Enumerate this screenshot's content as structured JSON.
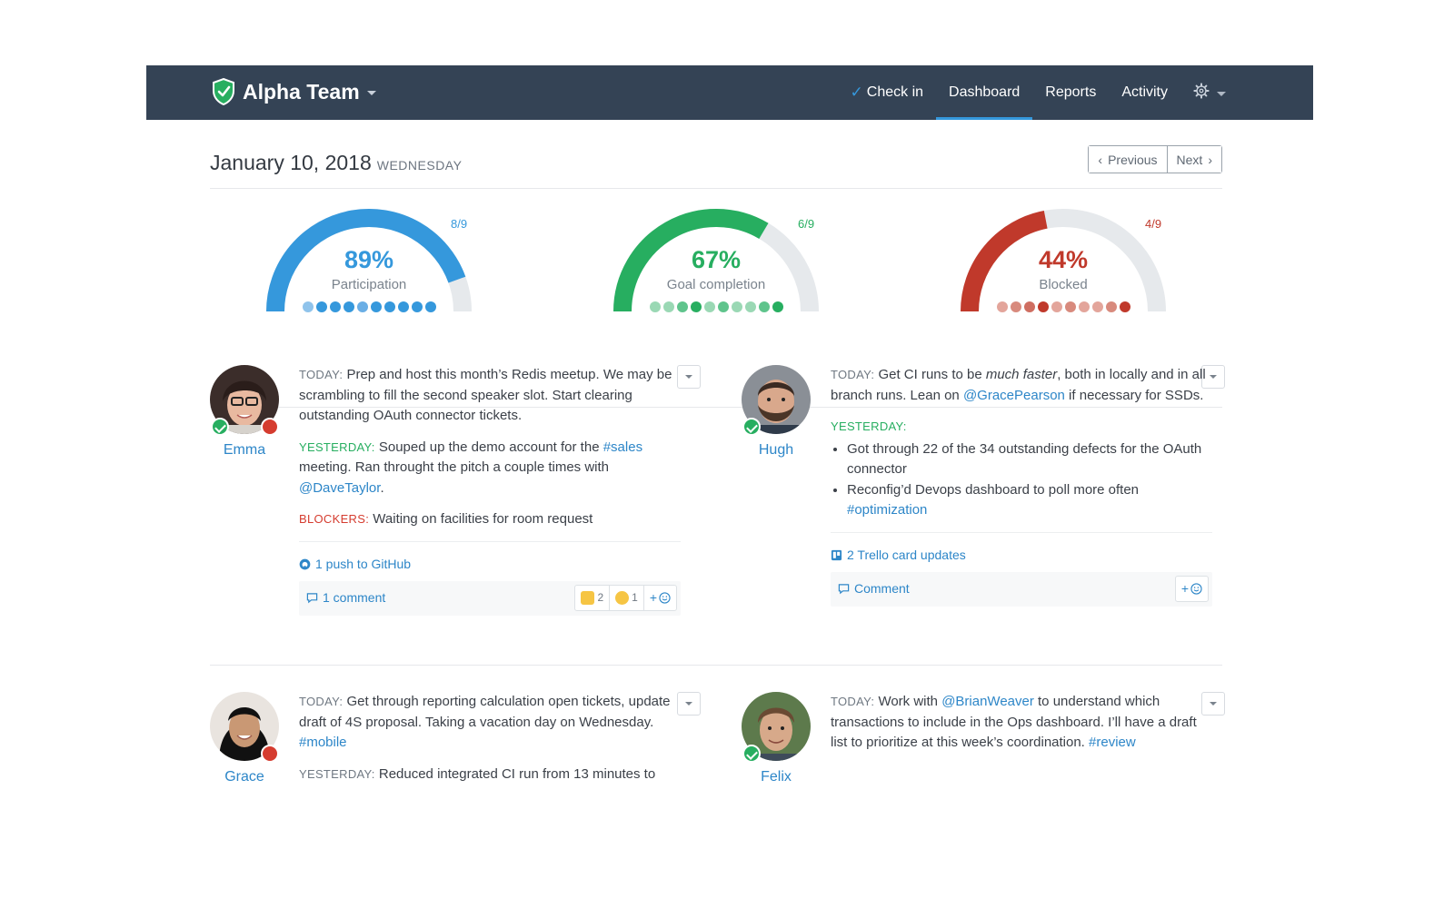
{
  "nav": {
    "team_name": "Alpha Team",
    "links": [
      {
        "label": "Check in",
        "active": false
      },
      {
        "label": "Dashboard",
        "active": true
      },
      {
        "label": "Reports",
        "active": false
      },
      {
        "label": "Activity",
        "active": false
      }
    ],
    "settings_icon": "gear-icon"
  },
  "date": {
    "main": "January 10, 2018",
    "day": "WEDNESDAY",
    "prev_label": "Previous",
    "next_label": "Next"
  },
  "gauges": [
    {
      "percent": 0.89,
      "percent_text": "89%",
      "label": "Participation",
      "fraction": "8/9",
      "color": "#3598dc",
      "dot_colors": [
        "#8fc3eb",
        "#3598dc",
        "#3598dc",
        "#3598dc",
        "#6aaee5",
        "#3598dc",
        "#3598dc",
        "#3598dc",
        "#3598dc",
        "#3598dc"
      ]
    },
    {
      "percent": 0.67,
      "percent_text": "67%",
      "label": "Goal completion",
      "fraction": "6/9",
      "color": "#27ae60",
      "dot_colors": [
        "#9ad8b4",
        "#9ad8b4",
        "#5fc48c",
        "#27ae60",
        "#9ad8b4",
        "#5fc48c",
        "#9ad8b4",
        "#9ad8b4",
        "#5fc48c",
        "#27ae60"
      ]
    },
    {
      "percent": 0.44,
      "percent_text": "44%",
      "label": "Blocked",
      "fraction": "4/9",
      "color": "#c0392b",
      "dot_colors": [
        "#e3a59b",
        "#d88a7d",
        "#cf6e61",
        "#c0392b",
        "#e3a59b",
        "#d88a7d",
        "#e3a59b",
        "#e3a59b",
        "#d88a7d",
        "#c0392b"
      ]
    }
  ],
  "entries": [
    {
      "name": "Emma",
      "today_label": "TODAY:",
      "today": "Prep and host this month’s Redis meetup. We may be scrambling to fill the second speaker slot. Start clearing outstanding OAuth connector tickets.",
      "yesterday_label": "YESTERDAY:",
      "yesterday_pre": "Souped up the demo account for the ",
      "yesterday_tag": "#sales",
      "yesterday_mid": " meeting. Ran throught the pitch a couple times with ",
      "yesterday_mention": "@DaveTaylor",
      "yesterday_post": ".",
      "blockers_label": "BLOCKERS:",
      "blockers": "Waiting on facilities for room request",
      "activity": "1 push to GitHub",
      "comment": "1 comment",
      "reactions": [
        {
          "emoji": "thumbs-up-emoji",
          "count": "2"
        },
        {
          "emoji": "laughing-emoji",
          "count": "1"
        }
      ],
      "add_reaction": "+"
    },
    {
      "name": "Hugh",
      "today_label": "TODAY:",
      "today_pre": "Get CI runs to be ",
      "today_em": "much faster",
      "today_mid": ", both in locally and in all branch runs. Lean on ",
      "today_mention": "@GracePearson",
      "today_post": " if necessary for SSDs.",
      "yesterday_label": "YESTERDAY:",
      "bullet1": "Got through 22 of the 34 outstanding defects for the OAuth connector",
      "bullet2_pre": "Reconfig’d Devops dashboard to poll more often ",
      "bullet2_tag": "#optimization",
      "activity": "2 Trello card updates",
      "comment": "Comment",
      "add_reaction": "+"
    },
    {
      "name": "Grace",
      "today_label": "TODAY:",
      "today_pre": "Get through reporting calculation open tick­ets, update draft of 4S proposal. Taking a vacation day on Wednesday. ",
      "today_tag": "#mobile",
      "yesterday_label": "YESTERDAY:",
      "yesterday": "Reduced integrated CI run from 13 minutes to"
    },
    {
      "name": "Felix",
      "today_label": "TODAY:",
      "today_pre": "Work with ",
      "today_mention": "@BrianWeaver",
      "today_mid": " to understand which transactions to include in the Ops dashboard. I’ll have a draft list to prioritize at this week’s coordina­tion. ",
      "today_tag": "#review"
    }
  ]
}
